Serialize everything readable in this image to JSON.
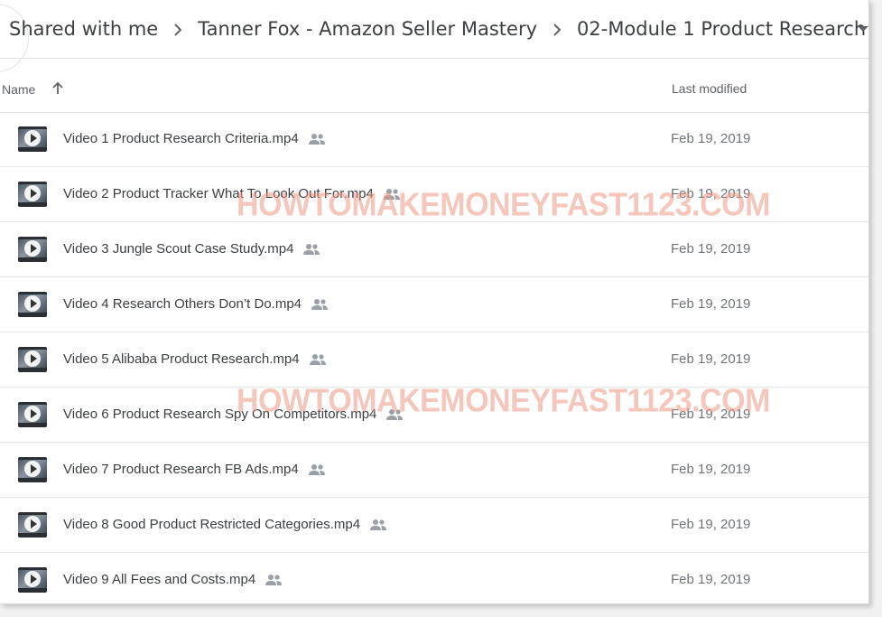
{
  "breadcrumb": {
    "items": [
      "Shared with me",
      "Tanner Fox - Amazon Seller Mastery",
      "02-Module 1 Product Research"
    ]
  },
  "list_header": {
    "name": "Name",
    "last_modified": "Last modified"
  },
  "files": [
    {
      "name": "Video 1 Product Research Criteria.mp4",
      "date": "Feb 19, 2019"
    },
    {
      "name": "Video 2 Product Tracker What To Look Out For.mp4",
      "date": "Feb 19, 2019"
    },
    {
      "name": "Video 3 Jungle Scout Case Study.mp4",
      "date": "Feb 19, 2019"
    },
    {
      "name": "Video 4 Research Others Don’t Do.mp4",
      "date": "Feb 19, 2019"
    },
    {
      "name": "Video 5 Alibaba Product Research.mp4",
      "date": "Feb 19, 2019"
    },
    {
      "name": "Video 6 Product Research Spy On Competitors.mp4",
      "date": "Feb 19, 2019"
    },
    {
      "name": "Video 7 Product Research FB Ads.mp4",
      "date": "Feb 19, 2019"
    },
    {
      "name": "Video 8 Good Product Restricted Categories.mp4",
      "date": "Feb 19, 2019"
    },
    {
      "name": "Video 9 All Fees and Costs.mp4",
      "date": "Feb 19, 2019"
    }
  ],
  "icons": {
    "breadcrumb_separator": "chevron-right-icon",
    "dropdown": "caret-down-icon",
    "sort": "arrow-up-icon",
    "file_type": "video-file-icon",
    "shared": "people-icon"
  },
  "watermark": {
    "text_1": "HOWTOMAKEMONEYFAST1123.COM",
    "text_2": "HOWTOMAKEMONEYFAST1123.COM"
  },
  "colors": {
    "text_primary": "#3c4043",
    "text_secondary": "#70757a",
    "watermark": "#ee9a86"
  }
}
